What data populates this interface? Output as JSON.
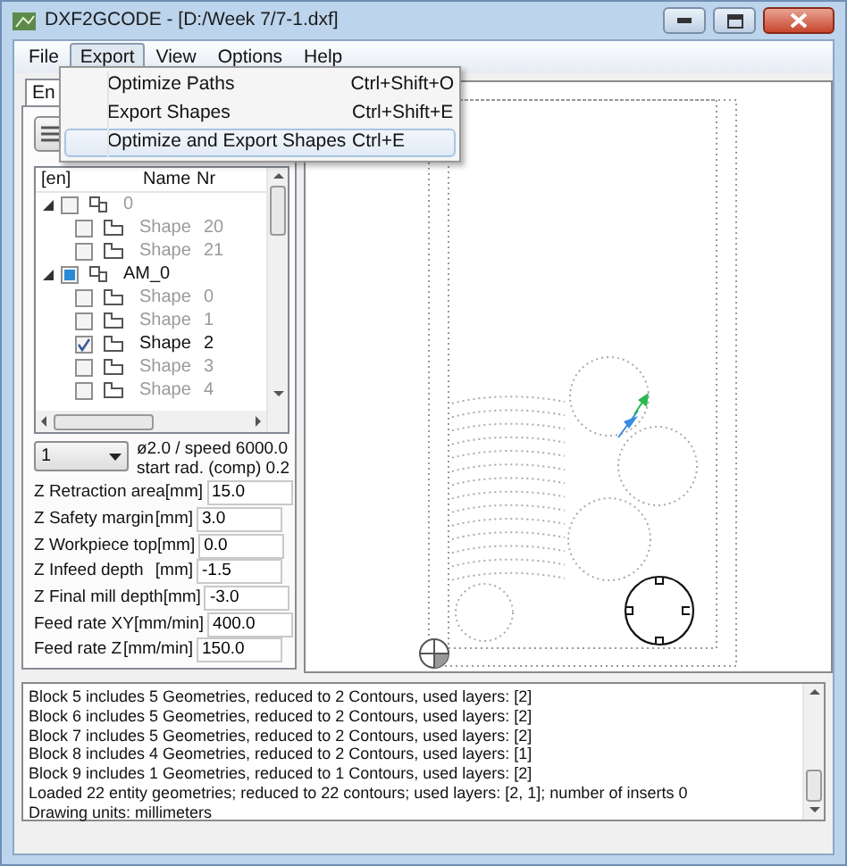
{
  "window": {
    "title": "DXF2GCODE - [D:/Week 7/7-1.dxf]"
  },
  "menu": [
    {
      "label": "File",
      "selected": false
    },
    {
      "label": "Export",
      "selected": true
    },
    {
      "label": "View",
      "selected": false
    },
    {
      "label": "Options",
      "selected": false
    },
    {
      "label": "Help",
      "selected": false
    }
  ],
  "export_menu": [
    {
      "label": "Optimize Paths",
      "shortcut": "Ctrl+Shift+O",
      "selected": false
    },
    {
      "label": "Export Shapes",
      "shortcut": "Ctrl+Shift+E",
      "selected": false
    },
    {
      "label": "Optimize and Export Shapes",
      "shortcut": "Ctrl+E",
      "selected": true
    }
  ],
  "tabs": [
    {
      "label": "En",
      "selected": true
    }
  ],
  "tree": {
    "columns": [
      "[en]",
      "Name",
      "Nr"
    ],
    "items": [
      {
        "kind": "group",
        "label": "0",
        "checked": false,
        "partial": false,
        "expanded": true,
        "children": [
          {
            "kind": "shape",
            "label": "Shape",
            "nr": "20",
            "checked": false
          },
          {
            "kind": "shape",
            "label": "Shape",
            "nr": "21",
            "checked": false
          }
        ]
      },
      {
        "kind": "group",
        "label": "AM_0",
        "checked": false,
        "partial": true,
        "expanded": true,
        "children": [
          {
            "kind": "shape",
            "label": "Shape",
            "nr": "0",
            "checked": false
          },
          {
            "kind": "shape",
            "label": "Shape",
            "nr": "1",
            "checked": false
          },
          {
            "kind": "shape",
            "label": "Shape",
            "nr": "2",
            "checked": true
          },
          {
            "kind": "shape",
            "label": "Shape",
            "nr": "3",
            "checked": false
          },
          {
            "kind": "shape",
            "label": "Shape",
            "nr": "4",
            "checked": false
          }
        ]
      }
    ]
  },
  "tool": {
    "value": "1",
    "info": [
      "ø2.0 / speed 6000.0",
      "start rad. (comp) 0.2"
    ]
  },
  "parameters": [
    {
      "label": "Z Retraction area",
      "unit": "[mm]",
      "value": "15.0"
    },
    {
      "label": "Z Safety margin",
      "unit": "[mm]",
      "value": "3.0"
    },
    {
      "label": "Z Workpiece top",
      "unit": "[mm]",
      "value": "0.0"
    },
    {
      "label": "Z Infeed depth",
      "unit": "[mm]",
      "value": "-1.5"
    },
    {
      "label": "Z Final mill depth",
      "unit": "[mm]",
      "value": "-3.0"
    },
    {
      "label": "Feed rate XY",
      "unit": "[mm/min]",
      "value": "400.0"
    },
    {
      "label": "Feed rate Z",
      "unit": "[mm/min]",
      "value": "150.0"
    }
  ],
  "log": [
    "Block 5 includes 5 Geometries, reduced to 2 Contours, used layers: [2]",
    "Block 6 includes 5 Geometries, reduced to 2 Contours, used layers: [2]",
    "Block 7 includes 5 Geometries, reduced to 2 Contours, used layers: [2]",
    "Block 8 includes 4 Geometries, reduced to 2 Contours, used layers: [1]",
    "Block 9 includes 1 Geometries, reduced to 1 Contours, used layers: [2]",
    "Loaded 22 entity geometries; reduced to 22 contours; used layers: [2, 1]; number of inserts 0",
    "Drawing units: millimeters"
  ]
}
